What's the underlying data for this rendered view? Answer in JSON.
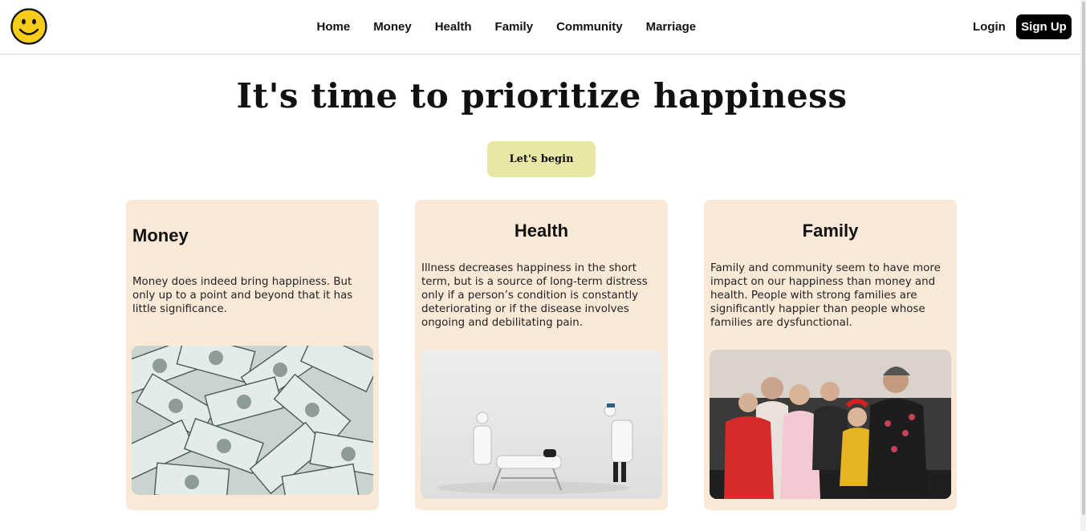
{
  "nav": {
    "logo_icon": "smiley-face-icon",
    "links": [
      "Home",
      "Money",
      "Health",
      "Family",
      "Community",
      "Marriage"
    ],
    "login": "Login",
    "signup": "Sign Up"
  },
  "hero": {
    "title": "It's time to prioritize happiness",
    "cta": "Let's begin"
  },
  "cards": [
    {
      "title": "Money",
      "text": "Money does indeed bring happiness. But only up to a point and beyond that it has little significance.",
      "image_icon": "dollar-bills-photo"
    },
    {
      "title": "Health",
      "text": "Illness decreases happiness in the short term, but is a source of long-term distress only if a person’s condition is constantly deteriorating or if the disease involves ongoing and debilitating pain.",
      "image_icon": "doctors-figurines-photo"
    },
    {
      "title": "Family",
      "text": "Family and community seem to have more impact on our happiness than money and health. People with strong families are significantly happier than people whose families are dysfunctional.",
      "image_icon": "family-group-photo"
    }
  ],
  "colors": {
    "card_bg": "#fae9d6",
    "cta_bg": "#e8e8a6",
    "smiley_yellow": "#f7cc1a",
    "signup_bg": "#000000"
  }
}
